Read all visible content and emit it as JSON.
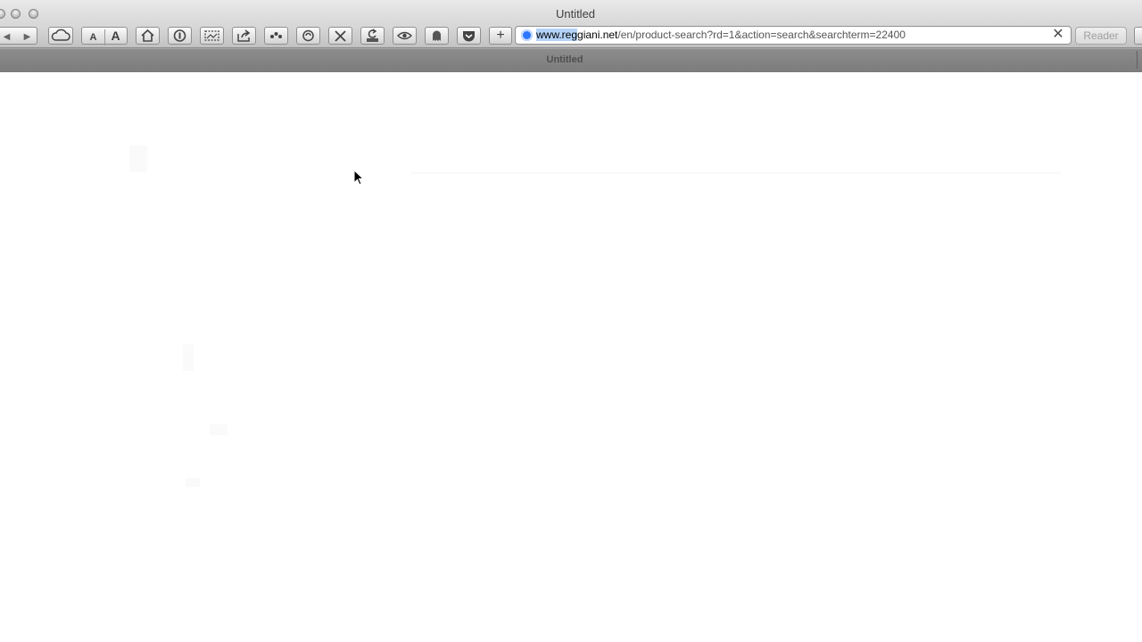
{
  "window": {
    "title": "Untitled"
  },
  "toolbar": {
    "back_icon": "chevron-left-icon",
    "forward_icon": "chevron-right-icon",
    "font_smaller_label": "A",
    "font_larger_label": "A",
    "add_label": "+",
    "reader_label": "Reader"
  },
  "address_bar": {
    "url_selected": "www.reg",
    "url_host_rest": "giani.net",
    "url_path": "/en/product-search?rd=1&action=search&searchterm=22400"
  },
  "tabs": [
    {
      "label": "Untitled"
    }
  ],
  "colors": {
    "selection": "#b3d2f8",
    "globe": "#2d76ff",
    "tab_bar": "#848484"
  }
}
